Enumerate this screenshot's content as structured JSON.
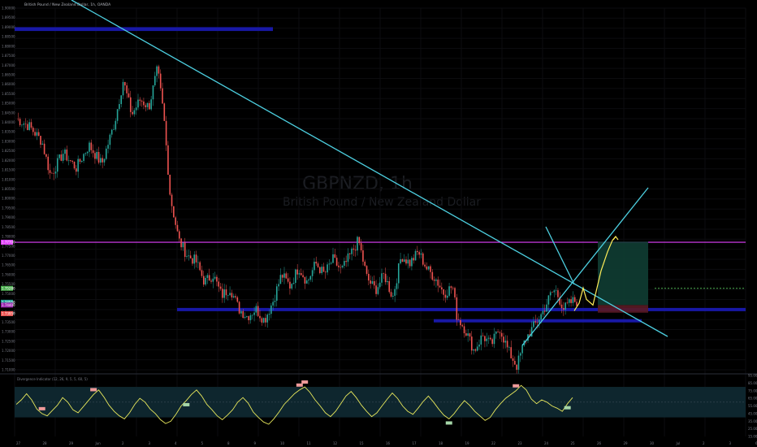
{
  "header": {
    "symbol_title": "British Pound / New Zealand Dollar, 1h, OANDA"
  },
  "watermark": {
    "ticker": "GBPNZD, 1h",
    "name": "British Pound / New Zealand Dollar"
  },
  "indicator": {
    "title": "Divergence Indicator (12, 26, 9, 5, 5, 60, 5)",
    "upper_level": 80,
    "lower_level": 40
  },
  "colors": {
    "background": "#000000",
    "candle_up": "#26a69a",
    "candle_down": "#ef5350",
    "trendline": "#4dd0e1",
    "zone": "#1a1ab3",
    "magenta_line": "#e040fb",
    "target_box": "#0f3d33",
    "stop_box": "#5a1a24",
    "projection_arrow": "#ffee58",
    "oscillator": "#e8e85c",
    "osc_band": "#0f2a33",
    "dotted_target": "#4caf50"
  },
  "chart_data": {
    "type": "candlestick",
    "symbol": "GBPNZD",
    "timeframe": "1h",
    "price_range": [
      1.71,
      1.9
    ],
    "path": [
      [
        0,
        1.842
      ],
      [
        6,
        1.838
      ],
      [
        12,
        1.83
      ],
      [
        16,
        1.812
      ],
      [
        22,
        1.824
      ],
      [
        28,
        1.816
      ],
      [
        34,
        1.828
      ],
      [
        40,
        1.818
      ],
      [
        46,
        1.84
      ],
      [
        50,
        1.862
      ],
      [
        54,
        1.844
      ],
      [
        58,
        1.852
      ],
      [
        62,
        1.848
      ],
      [
        66,
        1.868
      ],
      [
        69,
        1.843
      ],
      [
        72,
        1.801
      ],
      [
        76,
        1.778
      ],
      [
        80,
        1.77
      ],
      [
        84,
        1.767
      ],
      [
        88,
        1.756
      ],
      [
        92,
        1.76
      ],
      [
        96,
        1.749
      ],
      [
        100,
        1.753
      ],
      [
        104,
        1.742
      ],
      [
        108,
        1.738
      ],
      [
        112,
        1.742
      ],
      [
        116,
        1.736
      ],
      [
        120,
        1.746
      ],
      [
        124,
        1.76
      ],
      [
        128,
        1.754
      ],
      [
        132,
        1.764
      ],
      [
        136,
        1.756
      ],
      [
        140,
        1.766
      ],
      [
        144,
        1.76
      ],
      [
        148,
        1.768
      ],
      [
        152,
        1.762
      ],
      [
        156,
        1.77
      ],
      [
        160,
        1.778
      ],
      [
        164,
        1.758
      ],
      [
        168,
        1.752
      ],
      [
        172,
        1.76
      ],
      [
        176,
        1.748
      ],
      [
        180,
        1.77
      ],
      [
        184,
        1.766
      ],
      [
        188,
        1.772
      ],
      [
        192,
        1.763
      ],
      [
        196,
        1.758
      ],
      [
        200,
        1.75
      ],
      [
        204,
        1.754
      ],
      [
        206,
        1.738
      ],
      [
        210,
        1.731
      ],
      [
        214,
        1.72
      ],
      [
        218,
        1.728
      ],
      [
        222,
        1.723
      ],
      [
        226,
        1.732
      ],
      [
        230,
        1.72
      ],
      [
        234,
        1.712
      ],
      [
        238,
        1.726
      ],
      [
        242,
        1.733
      ],
      [
        246,
        1.74
      ],
      [
        250,
        1.75
      ],
      [
        252,
        1.752
      ],
      [
        256,
        1.742
      ],
      [
        260,
        1.746
      ]
    ],
    "path_x_range": [
      0,
      262
    ],
    "projection": [
      1.741,
      1.745,
      1.753,
      1.747,
      1.744,
      1.762,
      1.772,
      1.778,
      1.78
    ],
    "zones": [
      {
        "name": "top-resistance",
        "from": 1.888,
        "to": 1.89
      },
      {
        "name": "main-support",
        "from": 1.7408,
        "to": 1.7425
      },
      {
        "name": "lower-support",
        "from": 1.736,
        "to": 1.7366
      }
    ],
    "horizontal_line": 1.777,
    "target": 1.7528,
    "position": {
      "entry": 1.744,
      "take_profit": 1.7773,
      "stop_loss": 1.74
    },
    "oscillator": [
      57,
      63,
      71,
      63,
      51,
      45,
      42,
      49,
      56,
      66,
      60,
      50,
      46,
      54,
      62,
      70,
      76,
      67,
      56,
      48,
      42,
      38,
      46,
      57,
      65,
      60,
      51,
      45,
      37,
      32,
      35,
      44,
      55,
      62,
      70,
      76,
      68,
      57,
      50,
      42,
      37,
      43,
      50,
      60,
      66,
      59,
      47,
      40,
      34,
      31,
      38,
      47,
      57,
      64,
      71,
      76,
      80,
      73,
      63,
      55,
      46,
      41,
      48,
      58,
      68,
      74,
      66,
      56,
      48,
      41,
      46,
      55,
      64,
      72,
      65,
      55,
      48,
      44,
      52,
      61,
      68,
      60,
      51,
      43,
      38,
      45,
      54,
      62,
      56,
      48,
      42,
      36,
      40,
      50,
      58,
      65,
      70,
      75,
      82,
      76,
      64,
      58,
      63,
      60,
      55,
      52,
      48,
      58,
      66
    ]
  }
}
